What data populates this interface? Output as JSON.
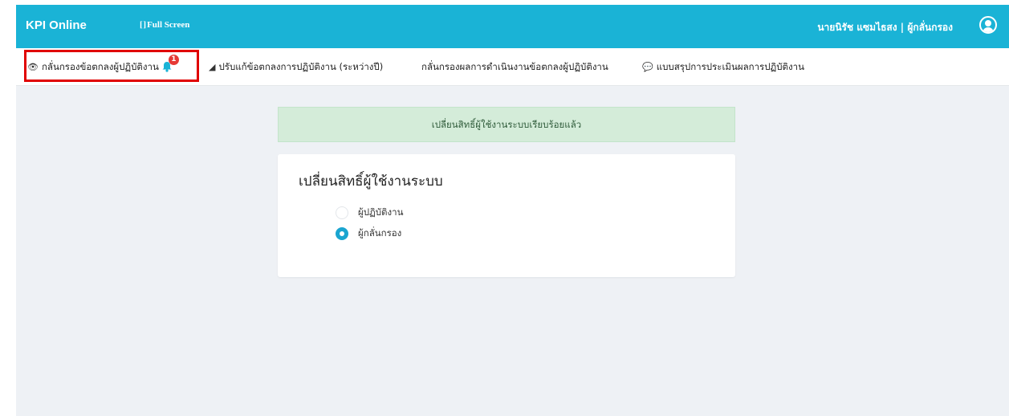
{
  "header": {
    "brand": "KPI Online",
    "fullscreen_label": "Full Screen",
    "user": "นายนิรัช แซมไธสง | ผู้กลั่นกรอง"
  },
  "nav": {
    "items": [
      {
        "label": "กลั่นกรองข้อตกลงผู้ปฏิบัติงาน",
        "icon": "eye-icon",
        "badge": "1"
      },
      {
        "label": "ปรับแก้ข้อตกลงการปฏิบัติงาน (ระหว่างปี)",
        "icon": "eraser-icon"
      },
      {
        "label": "กลั่นกรองผลการดำเนินงานข้อตกลงผู้ปฏิบัติงาน"
      },
      {
        "label": "แบบสรุปการประเมินผลการปฏิบัติงาน",
        "icon": "comment-icon"
      }
    ]
  },
  "alert": {
    "message": "เปลี่ยนสิทธิ์ผู้ใช้งานระบบเรียบร้อยแล้ว"
  },
  "role_card": {
    "title": "เปลี่ยนสิทธิ์ผู้ใช้งานระบบ",
    "options": [
      {
        "label": "ผู้ปฏิบัติงาน",
        "selected": false
      },
      {
        "label": "ผู้กลั่นกรอง",
        "selected": true
      }
    ]
  },
  "colors": {
    "topbar": "#1ab3d6",
    "accent": "#1aa5d0",
    "alert_bg": "#d4ecd9",
    "highlight": "#e00000",
    "badge": "#e53935"
  }
}
